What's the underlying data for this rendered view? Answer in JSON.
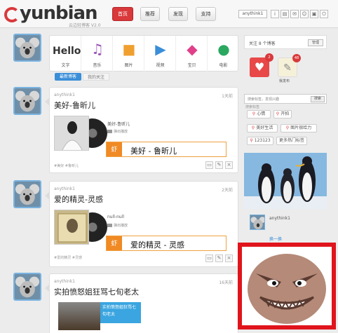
{
  "header": {
    "logo_text": "yunbian",
    "logo_sub": "云边轻博客 V2.0",
    "nav": [
      {
        "label": "首页",
        "active": true
      },
      {
        "label": "推荐",
        "active": false
      },
      {
        "label": "发现",
        "active": false
      },
      {
        "label": "支持",
        "active": false
      }
    ],
    "username": "anythink1"
  },
  "post_types": [
    {
      "label": "文字",
      "hello": "Hello"
    },
    {
      "label": "音乐",
      "icon": "♫"
    },
    {
      "label": "图片",
      "icon": "■"
    },
    {
      "label": "视频",
      "icon": "▶"
    },
    {
      "label": "宝贝",
      "icon": "◆"
    },
    {
      "label": "电影",
      "icon": "●"
    }
  ],
  "tabs": {
    "latest": "最新博客",
    "following": "我的关注"
  },
  "posts": [
    {
      "user": "anythink1",
      "time": "1天前",
      "title": "美好-鲁昕儿",
      "song": "美好-鲁昕儿",
      "popup": "弹出播放",
      "player_prefix": "虾",
      "player_text": "美好 - 鲁昕儿",
      "tags": "#美好 #鲁昕儿"
    },
    {
      "user": "anythink1",
      "time": "2天前",
      "title": "爱的精灵-灵感",
      "song": "null-null",
      "popup": "弹出播放",
      "player_prefix": "虾",
      "player_text": "爱的精灵 - 灵感",
      "tags": "#爱的精灵 #灵感"
    },
    {
      "user": "anythink1",
      "time": "16天前",
      "title": "实拍愤怒姐狂骂七旬老太",
      "video_label": "实拍愤怒姐狂骂七旬老太"
    }
  ],
  "sidebar": {
    "follow_text": "关注 8 个博客",
    "follow_btn": "管理",
    "badge_like": "2",
    "badge_doc": "48",
    "doc_label": "我发布",
    "search_label": "搜索标签",
    "search_placeholder": "搜索标签，发现兴趣",
    "search_btn": "搜索",
    "tags": [
      "心情",
      "开拍",
      "美好生活",
      "图片很给力",
      "123123",
      "更多热门标签"
    ],
    "mini_name": "anythink1",
    "mini_link": "换一换"
  }
}
